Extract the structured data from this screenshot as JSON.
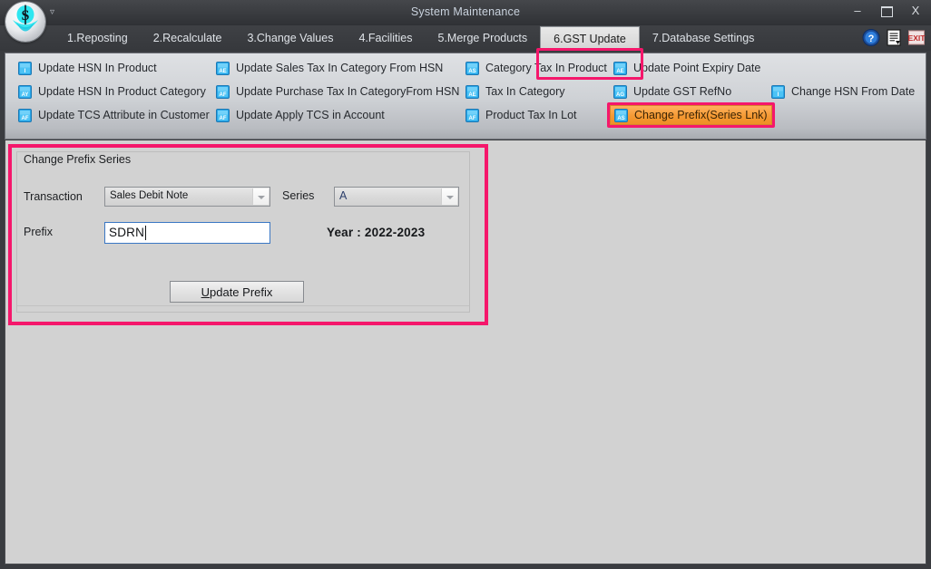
{
  "window": {
    "title": "System Maintenance",
    "logo_icon": "company-logo-icon",
    "menu_caret_icon": "menu-caret-icon",
    "minimize_label": "–",
    "maximize_icon": "maximize-icon",
    "close_label": "X"
  },
  "tabs": [
    {
      "label": "1.Reposting",
      "selected": false
    },
    {
      "label": "2.Recalculate",
      "selected": false
    },
    {
      "label": "3.Change Values",
      "selected": false
    },
    {
      "label": "4.Facilities",
      "selected": false
    },
    {
      "label": "5.Merge Products",
      "selected": false
    },
    {
      "label": "6.GST Update",
      "selected": true
    },
    {
      "label": "7.Database Settings",
      "selected": false
    }
  ],
  "title_icons": [
    {
      "name": "help-icon",
      "glyph": "?"
    },
    {
      "name": "report-icon",
      "glyph": "☰"
    },
    {
      "name": "exit-icon",
      "glyph": "EXIT"
    }
  ],
  "toolbar": {
    "items": [
      {
        "label": "Update HSN In Product",
        "icon": "hsn-product-icon",
        "badge": "I",
        "hot": false
      },
      {
        "label": "Update HSN In Product Category",
        "icon": "hsn-product-category-icon",
        "badge": "AY",
        "hot": false
      },
      {
        "label": "Update TCS Attribute in Customer",
        "icon": "tcs-customer-icon",
        "badge": "AF",
        "hot": false
      },
      {
        "label": "Update Sales Tax In Category From HSN",
        "icon": "sales-tax-category-icon",
        "badge": "AE",
        "hot": false
      },
      {
        "label": "Update Purchase Tax In CategoryFrom HSN",
        "icon": "purchase-tax-category-icon",
        "badge": "AF",
        "hot": false
      },
      {
        "label": "Update Apply TCS in Account",
        "icon": "apply-tcs-account-icon",
        "badge": "AF",
        "hot": false
      },
      {
        "label": "Category Tax In Product",
        "icon": "category-tax-product-icon",
        "badge": "AS",
        "hot": false
      },
      {
        "label": "Tax In Category",
        "icon": "tax-in-category-icon",
        "badge": "AE",
        "hot": false
      },
      {
        "label": "Product Tax In Lot",
        "icon": "product-tax-lot-icon",
        "badge": "AF",
        "hot": false
      },
      {
        "label": "Update Point Expiry Date",
        "icon": "point-expiry-icon",
        "badge": "AE",
        "hot": false
      },
      {
        "label": "Update GST RefNo",
        "icon": "gst-refno-icon",
        "badge": "AG",
        "hot": false
      },
      {
        "label": "Change Prefix(Series Lnk)",
        "icon": "change-prefix-icon",
        "badge": "AS",
        "hot": true
      },
      {
        "label": "Change HSN From Date",
        "icon": "change-hsn-date-icon",
        "badge": "I",
        "hot": false
      }
    ]
  },
  "form": {
    "group_title": "Change Prefix Series",
    "transaction_label": "Transaction",
    "transaction_value": "Sales Debit Note",
    "series_label": "Series",
    "series_value": "A",
    "prefix_label": "Prefix",
    "prefix_value": "SDRN",
    "year_text": "Year :  2022-2023",
    "update_button_accel": "U",
    "update_button_rest": "pdate Prefix"
  },
  "colors": {
    "annotation": "#f5176b",
    "hot_item": "#f59a34",
    "accent_text": "#c9d2dd",
    "panel_bg": "#d2d2d2"
  }
}
